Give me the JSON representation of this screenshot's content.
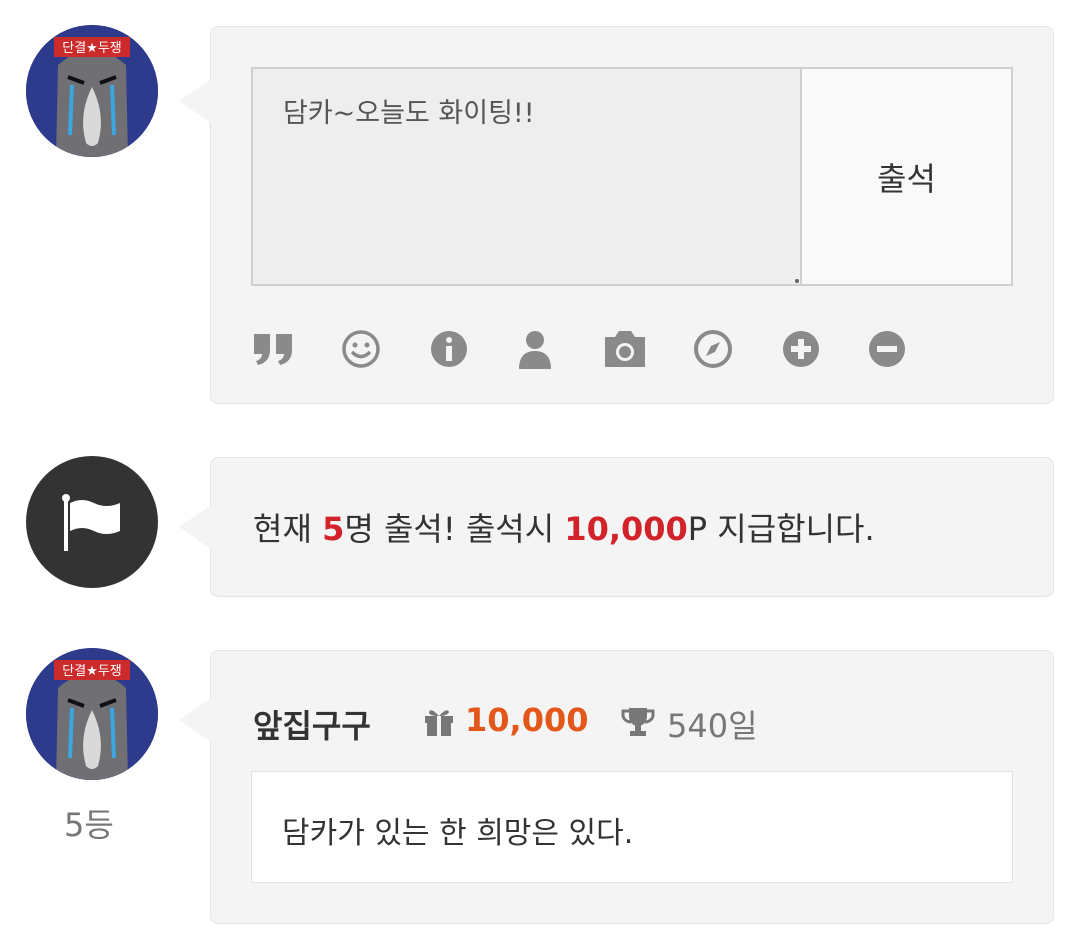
{
  "avatar_banner": "단결★두쟁",
  "composer": {
    "text_value": "담카~오늘도 화이팅!!",
    "submit_label": "출석",
    "tools": [
      "quote-icon",
      "smile-icon",
      "info-icon",
      "user-icon",
      "camera-icon",
      "compass-icon",
      "plus-circle-icon",
      "minus-circle-icon"
    ]
  },
  "notice": {
    "prefix": "현재 ",
    "count": "5",
    "middle": "명 출석! 출석시 ",
    "points": "10,000",
    "suffix": "P 지급합니다."
  },
  "entry": {
    "username": "앞집구구",
    "points": "10,000",
    "days": "540일",
    "message": "담카가 있는 한 희망은 있다.",
    "rank": "5등"
  },
  "colors": {
    "accent_red": "#d2232a",
    "accent_orange": "#e4571b",
    "bubble_bg": "#f4f4f4"
  }
}
